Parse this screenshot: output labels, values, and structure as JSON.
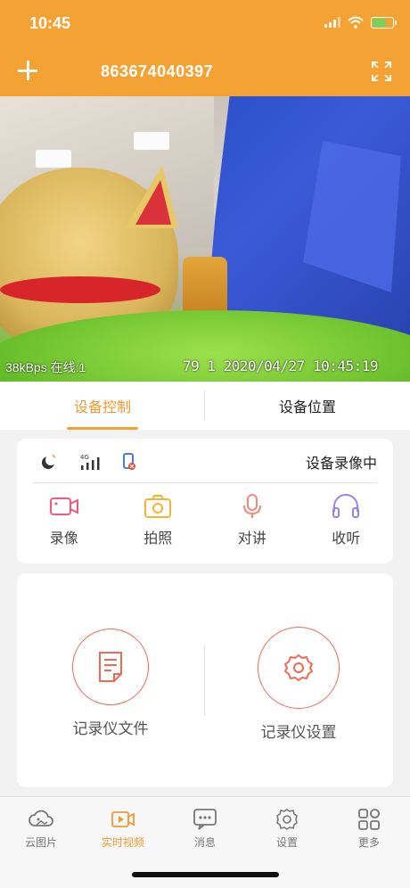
{
  "status_bar": {
    "time": "10:45"
  },
  "header": {
    "device_id": "863674040397"
  },
  "video": {
    "stats": "38kBps 在线:1",
    "timestamp": "79  1 2020/04/27 10:45:19"
  },
  "tabs": [
    {
      "label": "设备控制",
      "active": true
    },
    {
      "label": "设备位置",
      "active": false
    }
  ],
  "device_status": {
    "network_label": "4G",
    "record_status": "设备录像中"
  },
  "actions": [
    {
      "label": "录像",
      "icon": "video-camera-icon",
      "color": "#f15a7a"
    },
    {
      "label": "拍照",
      "icon": "camera-icon",
      "color": "#f5b335"
    },
    {
      "label": "对讲",
      "icon": "microphone-icon",
      "color": "#f28a7a"
    },
    {
      "label": "收听",
      "icon": "headphones-icon",
      "color": "#9a84ec"
    }
  ],
  "recorder": {
    "files_label": "记录仪文件",
    "settings_label": "记录仪设置"
  },
  "bottom_nav": [
    {
      "label": "云图片",
      "icon": "cloud-image-icon",
      "active": false
    },
    {
      "label": "实时视频",
      "icon": "live-video-icon",
      "active": true
    },
    {
      "label": "消息",
      "icon": "message-icon",
      "active": false
    },
    {
      "label": "设置",
      "icon": "settings-icon",
      "active": false
    },
    {
      "label": "更多",
      "icon": "more-grid-icon",
      "active": false
    }
  ],
  "colors": {
    "brand": "#f5a235",
    "accent_text": "#f29a2e",
    "recorder_ring": "#ef6a55"
  }
}
